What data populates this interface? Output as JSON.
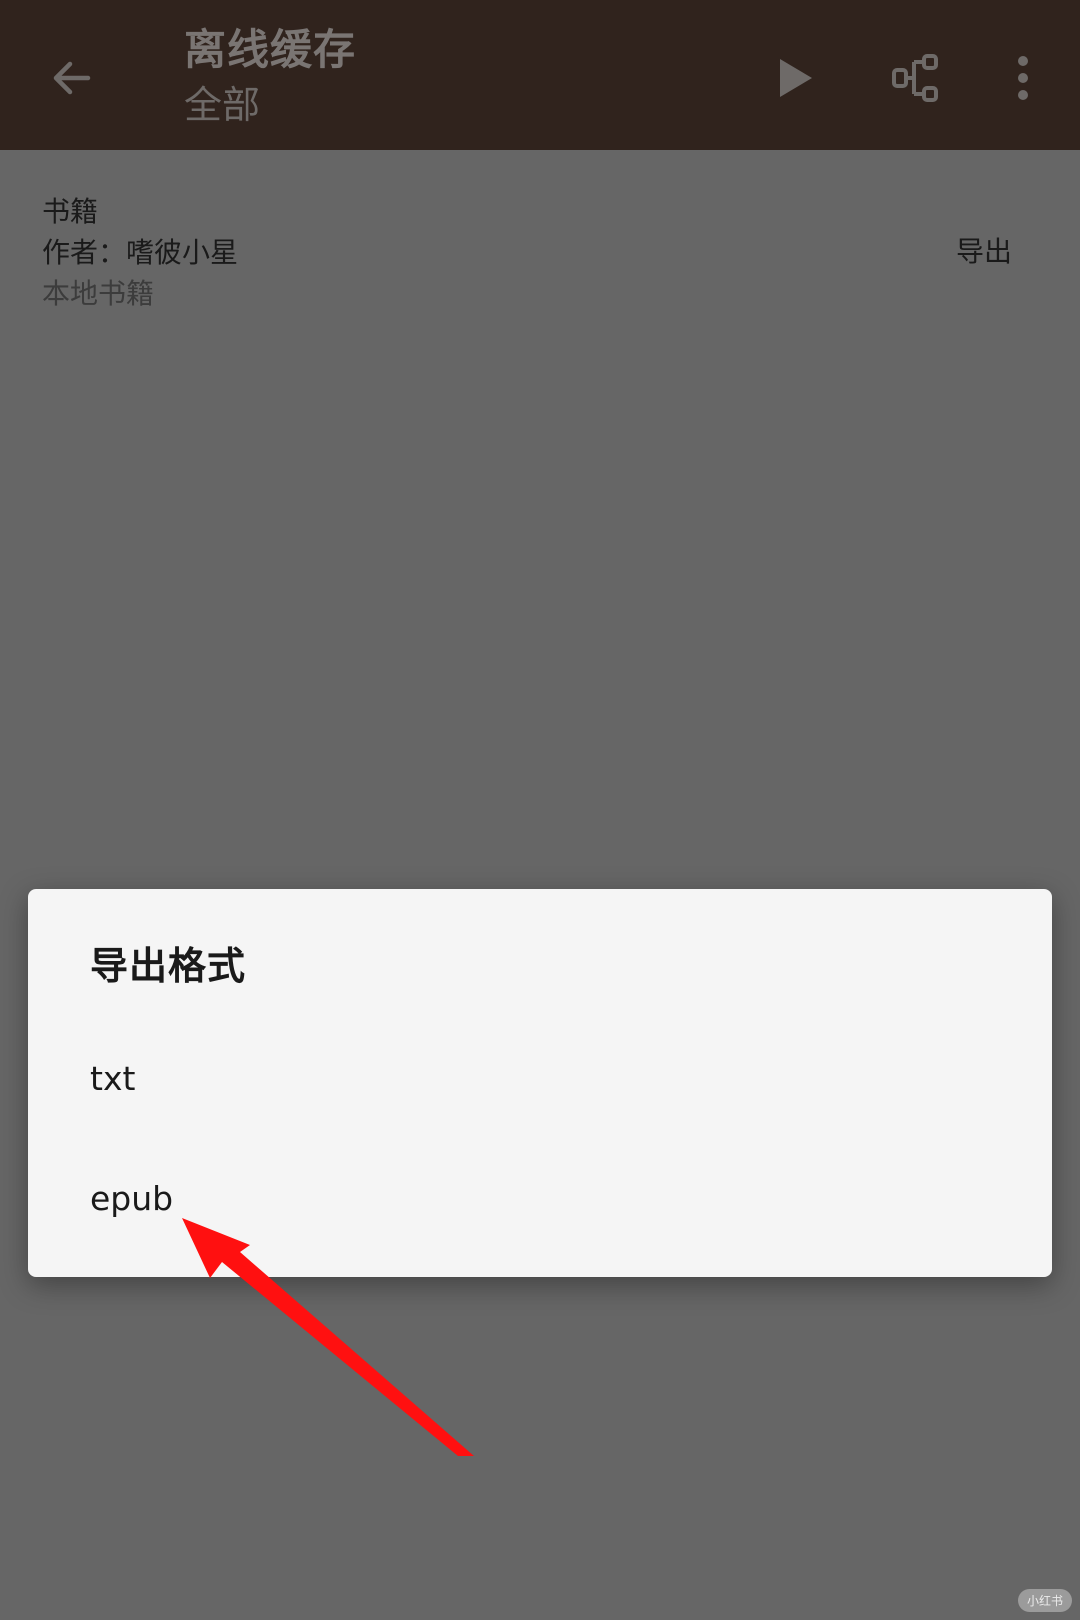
{
  "header": {
    "title": "离线缓存",
    "subtitle": "全部",
    "back_icon": "arrow-back-icon",
    "play_icon": "play-icon",
    "tree_icon": "tree-structure-icon",
    "more_icon": "more-vertical-icon"
  },
  "book": {
    "title": "书籍",
    "author": "作者：嗜彼小星",
    "source": "本地书籍",
    "export_label": "导出"
  },
  "dialog": {
    "title": "导出格式",
    "options": [
      {
        "label": "txt"
      },
      {
        "label": "epub"
      }
    ]
  },
  "annotation": {
    "color": "#ff1010",
    "target": "epub"
  },
  "watermark": {
    "text": "小红书"
  },
  "colors": {
    "app_bar": "#30231d",
    "scrim": "#666666",
    "dialog_bg": "#f5f5f5"
  }
}
